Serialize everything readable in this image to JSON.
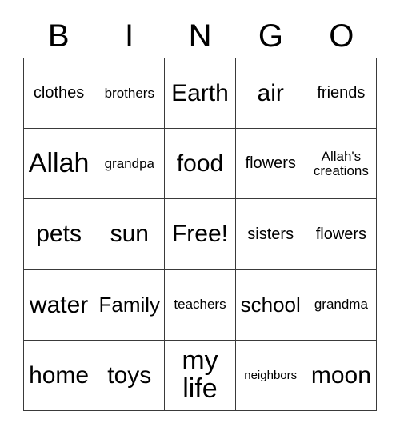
{
  "header": {
    "letters": [
      "B",
      "I",
      "N",
      "G",
      "O"
    ]
  },
  "grid": {
    "rows": 5,
    "columns": 5,
    "border_color": "#3a3a3a",
    "background_color": "#ffffff",
    "text_color": "#000000",
    "cells": [
      {
        "text": "clothes",
        "size": "m"
      },
      {
        "text": "brothers",
        "size": "s"
      },
      {
        "text": "Earth",
        "size": "xxl"
      },
      {
        "text": "air",
        "size": "xxl"
      },
      {
        "text": "friends",
        "size": "m"
      },
      {
        "text": "Allah",
        "size": "huge"
      },
      {
        "text": "grandpa",
        "size": "s"
      },
      {
        "text": "food",
        "size": "xxl"
      },
      {
        "text": "flowers",
        "size": "m"
      },
      {
        "text": "Allah's\ncreations",
        "size": "s"
      },
      {
        "text": "pets",
        "size": "xxl"
      },
      {
        "text": "sun",
        "size": "xxl"
      },
      {
        "text": "Free!",
        "size": "xxl"
      },
      {
        "text": "sisters",
        "size": "m"
      },
      {
        "text": "flowers",
        "size": "m"
      },
      {
        "text": "water",
        "size": "xxl"
      },
      {
        "text": "Family",
        "size": "xl"
      },
      {
        "text": "teachers",
        "size": "s"
      },
      {
        "text": "school",
        "size": "xl"
      },
      {
        "text": "grandma",
        "size": "s"
      },
      {
        "text": "home",
        "size": "xxl"
      },
      {
        "text": "toys",
        "size": "xxl"
      },
      {
        "text": "my\nlife",
        "size": "huge"
      },
      {
        "text": "neighbors",
        "size": "xs"
      },
      {
        "text": "moon",
        "size": "xxl"
      }
    ]
  }
}
